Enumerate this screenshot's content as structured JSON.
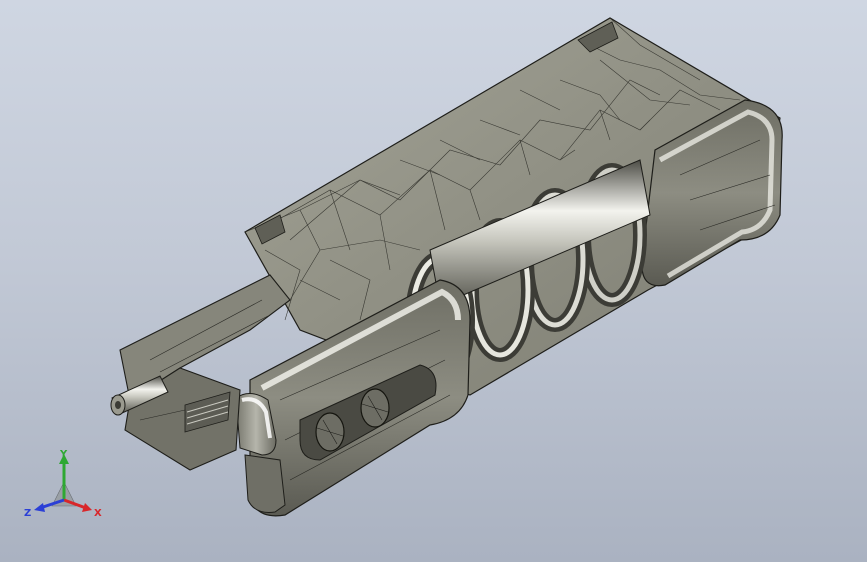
{
  "view": {
    "background_top": "#cfd6e2",
    "background_bottom": "#aab2c1",
    "model_color": "#8a8a7e",
    "edge_color": "#1e1e1a"
  },
  "triad": {
    "x_label": "X",
    "y_label": "Y",
    "z_label": "Z",
    "x_color": "#d8262a",
    "y_color": "#2ea832",
    "z_color": "#2b3fd6"
  }
}
